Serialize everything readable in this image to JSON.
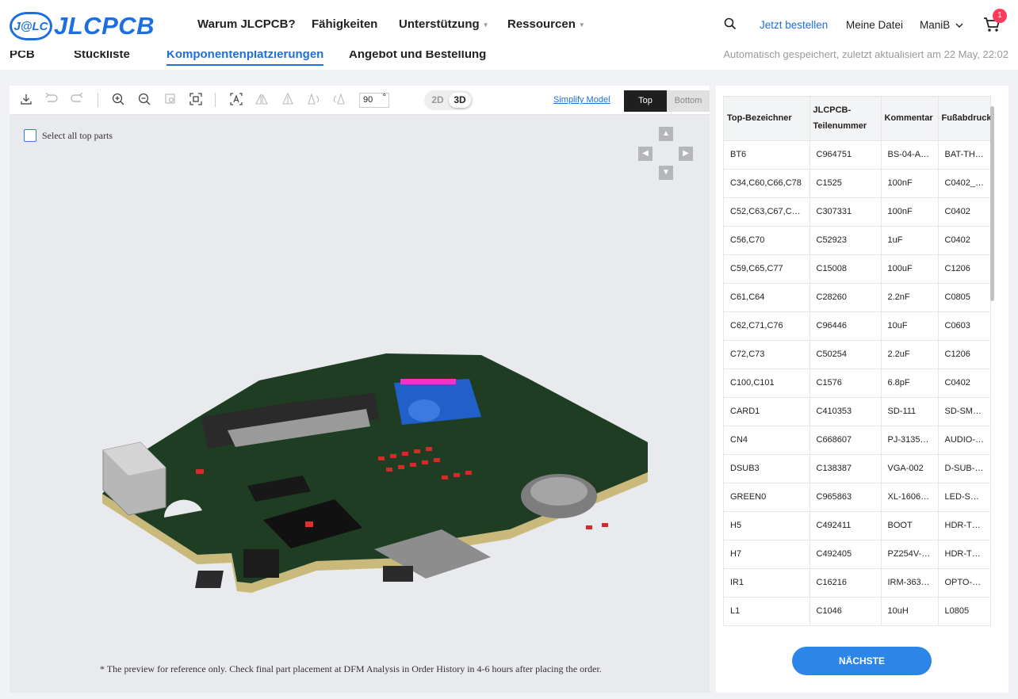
{
  "header": {
    "logo_badge": "J@LC",
    "logo_text": "JLCPCB",
    "nav": [
      {
        "label": "Warum JLCPCB?",
        "dropdown": false
      },
      {
        "label": "Fähigkeiten",
        "dropdown": false
      },
      {
        "label": "Unterstützung",
        "dropdown": true
      },
      {
        "label": "Ressourcen",
        "dropdown": true
      }
    ],
    "order_now": "Jetzt bestellen",
    "my_files": "Meine Datei",
    "user": "ManiB",
    "cart_count": "1"
  },
  "tabs": {
    "pcb": "PCB",
    "bom": "Stückliste",
    "placement": "Komponentenplatzierungen",
    "quote": "Angebot und Bestellung",
    "autosave": "Automatisch gespeichert, zuletzt aktualisiert am 22 May, 22:02"
  },
  "viewer": {
    "rotation_angle": "90",
    "degree_symbol": "°",
    "mode_2d": "2D",
    "mode_3d": "3D",
    "active_mode": "3D",
    "simplify_label": "Simplify Model",
    "side_top": "Top",
    "side_bottom": "Bottom",
    "active_side": "Top",
    "select_all_label": "Select all top parts",
    "disclaimer": "* The preview for reference only. Check final part placement at DFM Analysis in Order History in 4-6 hours after placing the order."
  },
  "table": {
    "headers": [
      "Top-Bezeichner",
      "JLCPCB-Teilenummer",
      "Kommentar",
      "Fußabdruck"
    ],
    "rows": [
      [
        "BT6",
        "C964751",
        "BS-04-A1…",
        "BAT-TH_…"
      ],
      [
        "C34,C60,C66,C78",
        "C1525",
        "100nF",
        "C0402_N…"
      ],
      [
        "C52,C63,C67,C6…",
        "C307331",
        "100nF",
        "C0402"
      ],
      [
        "C56,C70",
        "C52923",
        "1uF",
        "C0402"
      ],
      [
        "C59,C65,C77",
        "C15008",
        "100uF",
        "C1206"
      ],
      [
        "C61,C64",
        "C28260",
        "2.2nF",
        "C0805"
      ],
      [
        "C62,C71,C76",
        "C96446",
        "10uF",
        "C0603"
      ],
      [
        "C72,C73",
        "C50254",
        "2.2uF",
        "C1206"
      ],
      [
        "C100,C101",
        "C1576",
        "6.8pF",
        "C0402"
      ],
      [
        "CARD1",
        "C410353",
        "SD-111",
        "SD-SMD_…"
      ],
      [
        "CN4",
        "C668607",
        "PJ-3135J…",
        "AUDIO-T…"
      ],
      [
        "DSUB3",
        "C138387",
        "VGA-002",
        "D-SUB-T…"
      ],
      [
        "GREEN0",
        "C965863",
        "XL-1606…",
        "LED-SMD…"
      ],
      [
        "H5",
        "C492411",
        "BOOT",
        "HDR-TH_…"
      ],
      [
        "H7",
        "C492405",
        "PZ254V-…",
        "HDR-TH_…"
      ],
      [
        "IR1",
        "C16216",
        "IRM-363…",
        "OPTO-T…"
      ],
      [
        "L1",
        "C1046",
        "10uH",
        "L0805"
      ]
    ],
    "next_button": "NÄCHSTE"
  }
}
